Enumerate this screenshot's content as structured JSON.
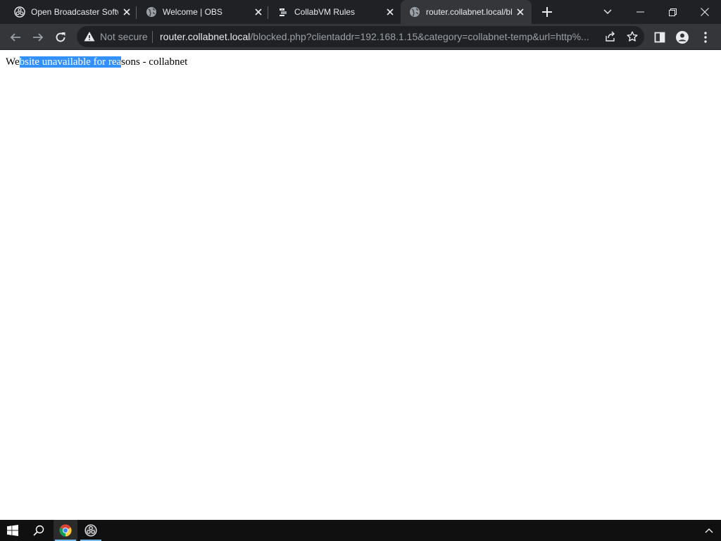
{
  "browser": {
    "tabs": [
      {
        "title": "Open Broadcaster Software",
        "favicon": "obs-icon",
        "active": false
      },
      {
        "title": "Welcome | OBS",
        "favicon": "globe-icon",
        "active": false
      },
      {
        "title": "CollabVM Rules",
        "favicon": "collabvm-icon",
        "active": false
      },
      {
        "title": "router.collabnet.local/blocked.php",
        "favicon": "globe-icon",
        "active": true
      }
    ],
    "security_label": "Not secure",
    "url_host": "router.collabnet.local",
    "url_path": "/blocked.php?clientaddr=192.168.1.15&category=collabnet-temp&url=http%..."
  },
  "page": {
    "text_before": "We",
    "text_selected": "bsite unavailable for rea",
    "text_after": "sons - collabnet"
  },
  "colors": {
    "tabstrip": "#202124",
    "toolbar": "#35363a",
    "omnibox": "#202124",
    "selection": "#3390ff",
    "taskbar": "#101010"
  }
}
